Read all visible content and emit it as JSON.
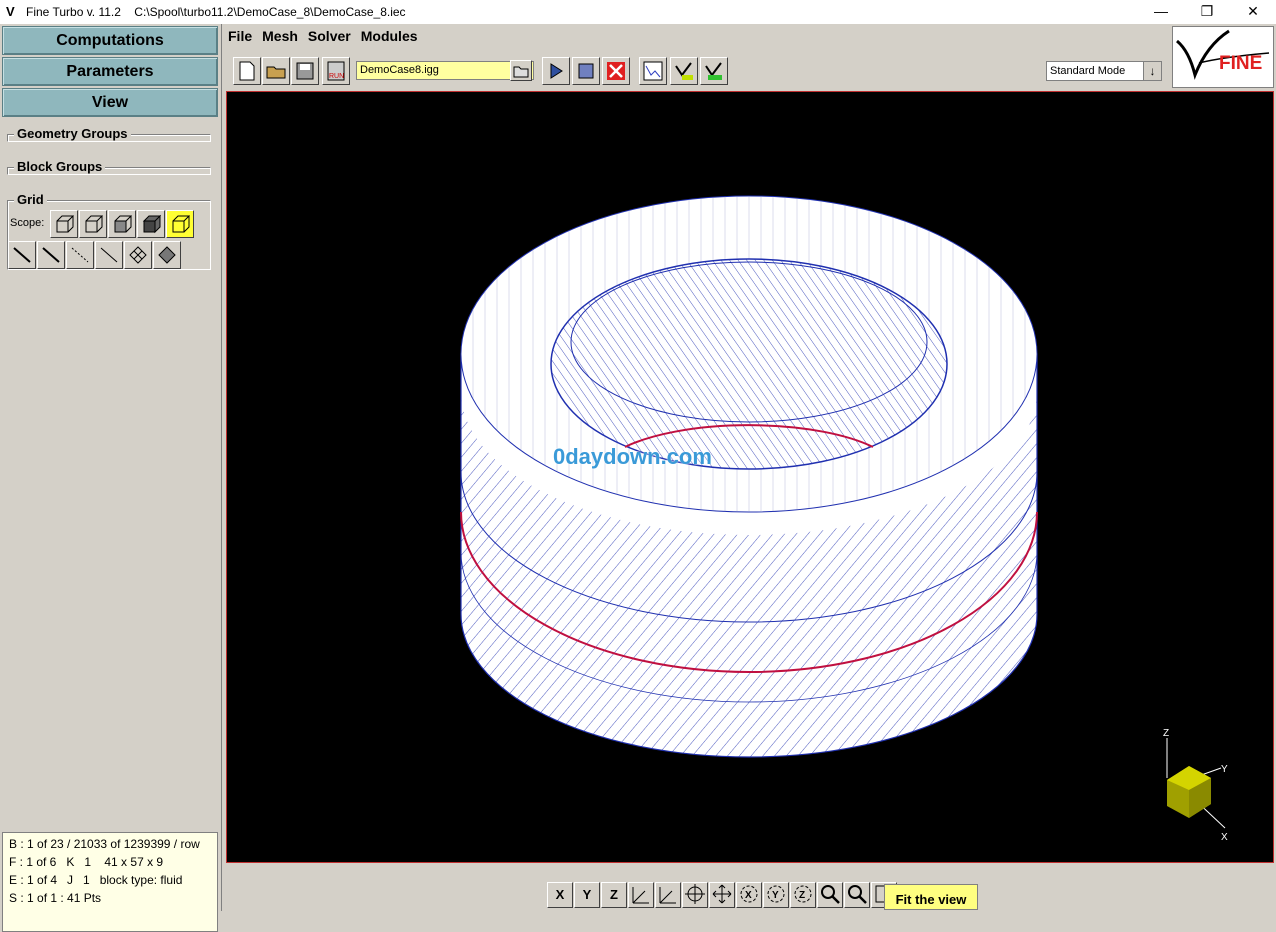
{
  "window": {
    "title": "Fine Turbo v. 11.2    C:\\Spool\\turbo11.2\\DemoCase_8\\DemoCase_8.iec",
    "minimize": "—",
    "maximize": "❐",
    "close": "✕"
  },
  "nav": {
    "computations": "Computations",
    "parameters": "Parameters",
    "view": "View"
  },
  "groups": {
    "geometry": "Geometry Groups",
    "block": "Block Groups",
    "grid": "Grid",
    "scope_label": "Scope:"
  },
  "menu": [
    "File",
    "Mesh",
    "Solver",
    "Modules"
  ],
  "toolbar": {
    "file_name": "DemoCase8.igg",
    "mode": "Standard Mode",
    "logo_text": "FINE"
  },
  "status": {
    "line1": "B : 1 of 23 / 21033 of 1239399 / row",
    "line2": "F : 1 of 6   K   1    41 x 57 x 9",
    "line3": "E : 1 of 4   J   1   block type: fluid",
    "line4": "S : 1 of 1 : 41 Pts"
  },
  "viewport": {
    "watermark": "0daydown.com",
    "axis_x": "X",
    "axis_y": "Y",
    "axis_z": "Z"
  },
  "bottom_toolbar": {
    "x_btn": "X",
    "y_btn": "Y",
    "z_btn": "Z",
    "tooltip": "Fit the view"
  }
}
